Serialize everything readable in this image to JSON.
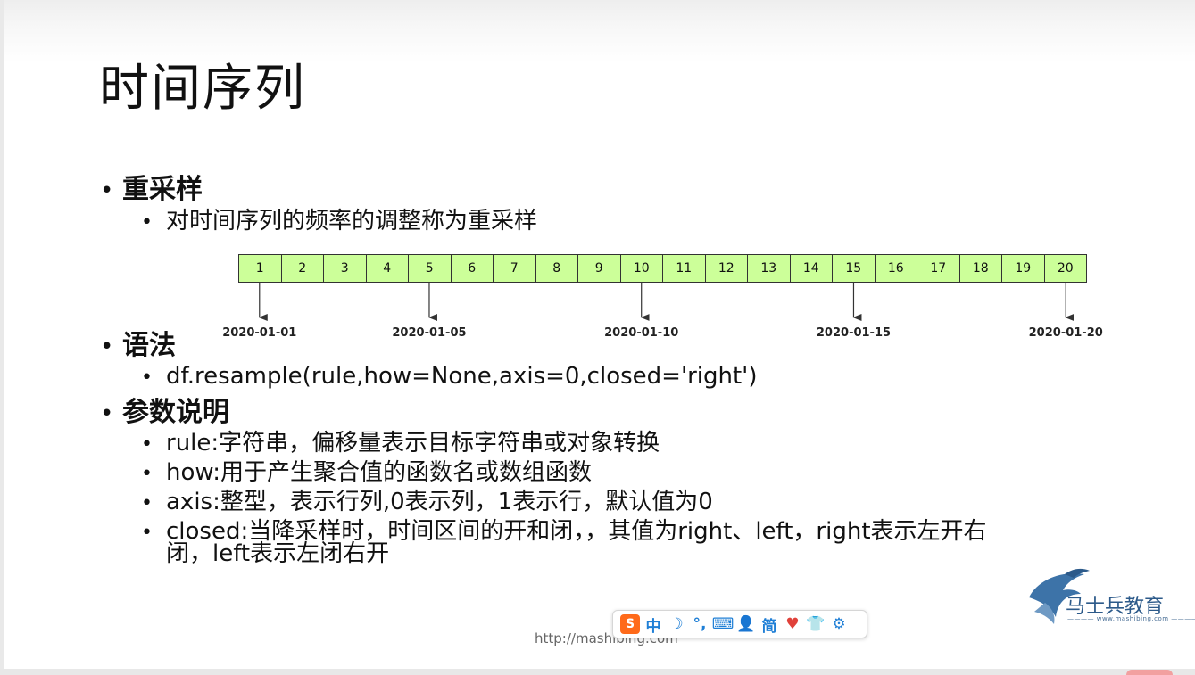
{
  "slide": {
    "title": "时间序列",
    "sections": [
      {
        "heading": "重采样",
        "items": [
          "对时间序列的频率的调整称为重采样"
        ]
      },
      {
        "heading": "语法",
        "items": [
          "df.resample(rule,how=None,axis=0,closed='right')"
        ]
      },
      {
        "heading": "参数说明",
        "items": [
          "rule:字符串，偏移量表示目标字符串或对象转换",
          "how:用于产生聚合值的函数名或数组函数",
          "axis:整型，表示行列,0表示列，1表示行，默认值为0",
          "closed:当降采样时，时间区间的开和闭，，其值为right、left，right表示左开右",
          "闭，left表示左闭右开"
        ]
      }
    ]
  },
  "timeline": {
    "cells": [
      "1",
      "2",
      "3",
      "4",
      "5",
      "6",
      "7",
      "8",
      "9",
      "10",
      "11",
      "12",
      "13",
      "14",
      "15",
      "16",
      "17",
      "18",
      "19",
      "20"
    ],
    "fill_color": "#ccff99",
    "markers": [
      {
        "cell": 1,
        "date": "2020-01-01"
      },
      {
        "cell": 5,
        "date": "2020-01-05"
      },
      {
        "cell": 10,
        "date": "2020-01-10"
      },
      {
        "cell": 15,
        "date": "2020-01-15"
      },
      {
        "cell": 20,
        "date": "2020-01-20"
      }
    ]
  },
  "footer": {
    "url": "http://mashibing.com",
    "logo_text": "马士兵教育",
    "logo_subtext": "www.mashibing.com",
    "brand_color": "#2c5a8a"
  },
  "ime_toolbar": {
    "items": [
      {
        "name": "sogou-logo-icon",
        "label": "S"
      },
      {
        "name": "chinese-mode-button",
        "label": "中"
      },
      {
        "name": "moon-icon",
        "label": "☽"
      },
      {
        "name": "punctuation-icon",
        "label": "°,"
      },
      {
        "name": "keyboard-icon",
        "label": "⌨"
      },
      {
        "name": "user-icon",
        "label": "👤"
      },
      {
        "name": "simplified-button",
        "label": "简"
      },
      {
        "name": "skin-icon",
        "label": "♥"
      },
      {
        "name": "shirt-icon",
        "label": "👕"
      },
      {
        "name": "gear-icon",
        "label": "⚙"
      }
    ]
  }
}
